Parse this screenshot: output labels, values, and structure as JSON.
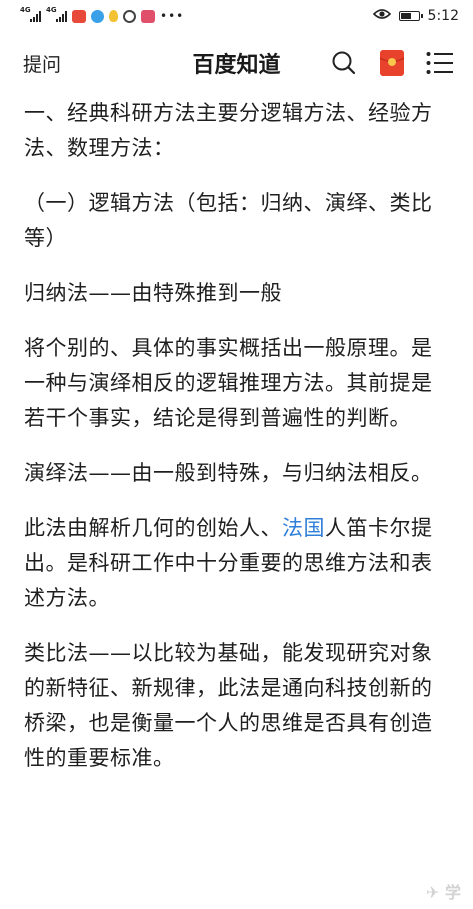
{
  "status_bar": {
    "network_1": "4G",
    "network_2": "4G",
    "time": "5:12",
    "battery_level": 0.6
  },
  "nav": {
    "ask_label": "提问",
    "title": "百度知道",
    "icons": [
      "search-icon",
      "red-packet-icon",
      "menu-icon"
    ]
  },
  "article": {
    "p1": "一、经典科研方法主要分逻辑方法、经验方法、数理方法：",
    "p2": "（一）逻辑方法（包括：归纳、演绎、类比等）",
    "p3": "归纳法——由特殊推到一般",
    "p4": "将个别的、具体的事实概括出一般原理。是一种与演绎相反的逻辑推理方法。其前提是若干个事实，结论是得到普遍性的判断。",
    "p5": "演绎法——由一般到特殊，与归纳法相反。",
    "p6_before": "此法由解析几何的创始人、",
    "p6_link": "法国",
    "p6_after": "人笛卡尔提出。是科研工作中十分重要的思维方法和表述方法。",
    "p7": "类比法——以比较为基础，能发现研究对象的新特征、新规律，此法是通向科技创新的桥梁，也是衡量一个人的思维是否具有创造性的重要标准。"
  },
  "colors": {
    "link": "#2e7fd9",
    "red_packet": "#e8412c"
  }
}
